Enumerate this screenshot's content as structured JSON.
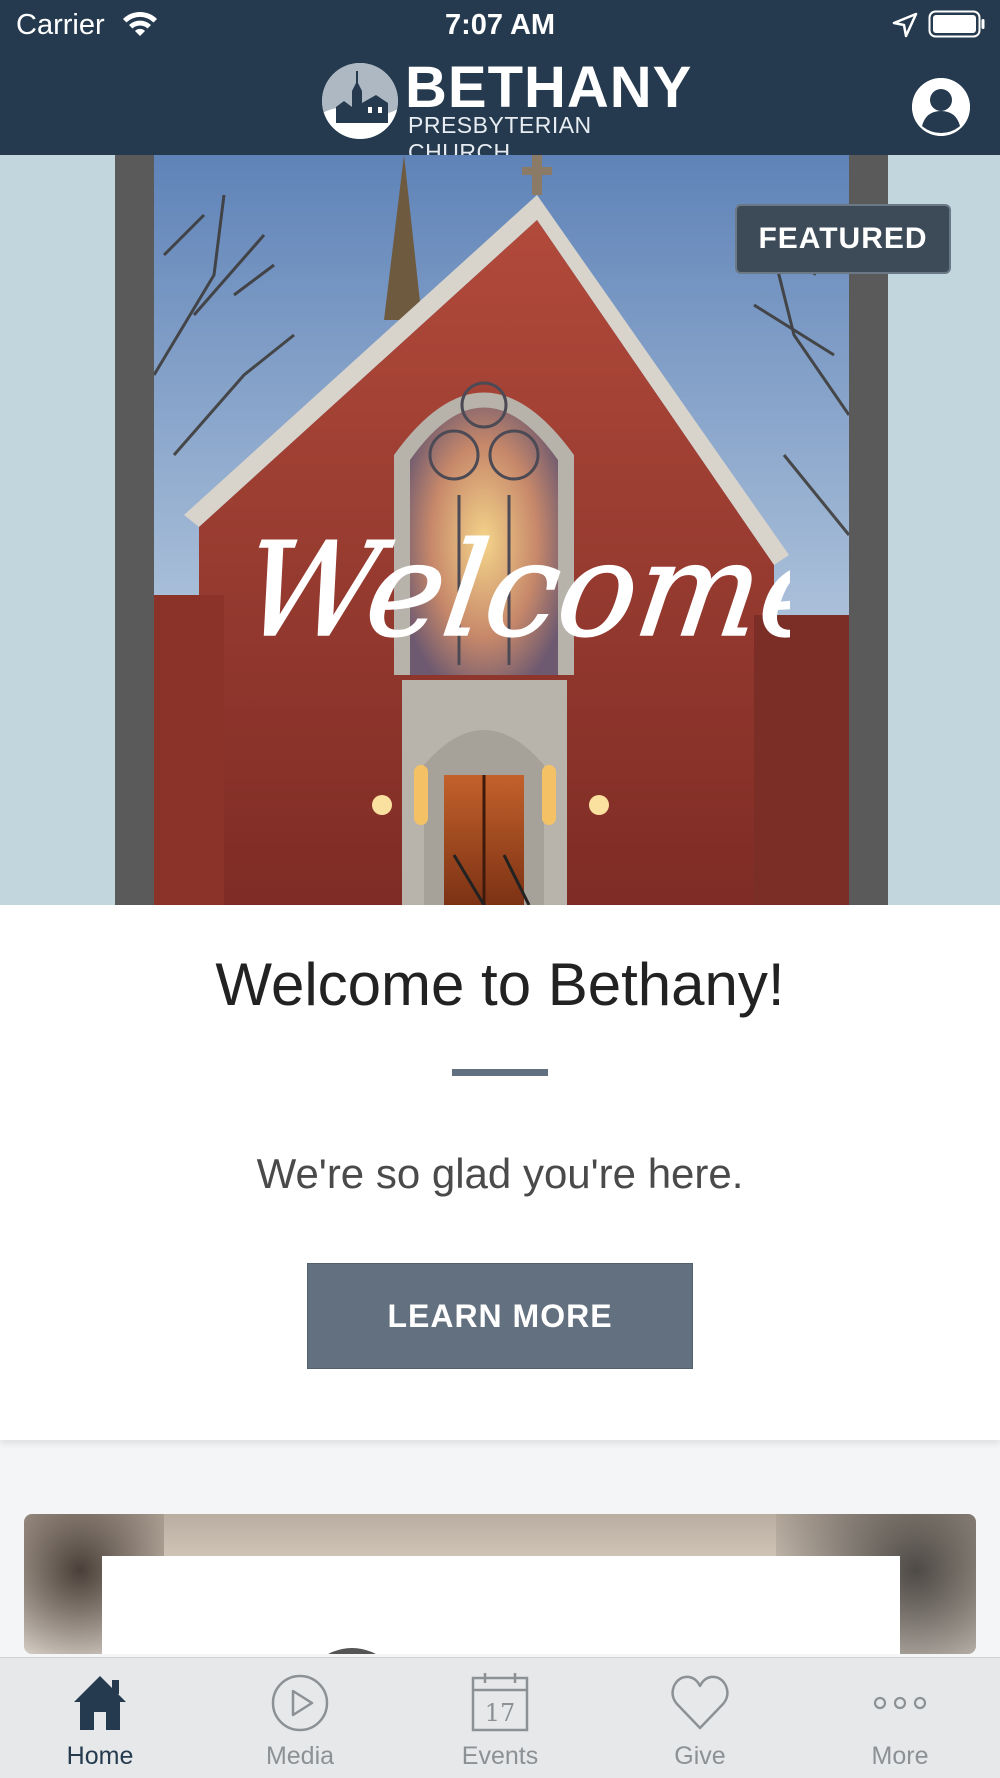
{
  "status_bar": {
    "carrier": "Carrier",
    "time": "7:07 AM"
  },
  "header": {
    "brand_name": "BETHANY",
    "brand_subtitle": "PRESBYTERIAN CHURCH",
    "profile_icon": "person-circle-icon",
    "background_color": "#253a4e"
  },
  "featured_card": {
    "badge": "FEATURED",
    "hero_image_text": "Welcome",
    "title": "Welcome to Bethany!",
    "tagline": "We're so glad you're here.",
    "button_label": "LEARN MORE",
    "button_color": "#637080"
  },
  "tab_bar": {
    "active_color": "#253a4e",
    "inactive_color": "#8c9196",
    "items": [
      {
        "label": "Home",
        "icon": "home-icon",
        "active": true
      },
      {
        "label": "Media",
        "icon": "play-circle-icon",
        "active": false
      },
      {
        "label": "Events",
        "icon": "calendar-icon",
        "active": false,
        "icon_text": "17"
      },
      {
        "label": "Give",
        "icon": "heart-icon",
        "active": false
      },
      {
        "label": "More",
        "icon": "more-dots-icon",
        "active": false
      }
    ]
  }
}
